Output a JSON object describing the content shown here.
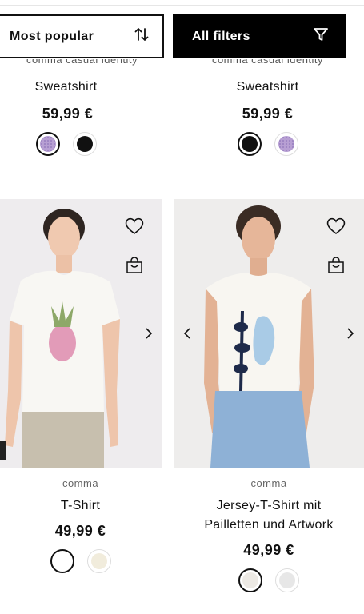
{
  "toolbar": {
    "sort_label": "Most popular",
    "filter_label": "All filters"
  },
  "products_top": [
    {
      "brand": "comma casual identity",
      "title": "Sweatshirt",
      "price": "59,99 €",
      "swatches": [
        {
          "color": "#b79fd3",
          "selected": true
        },
        {
          "color": "#111111",
          "selected": false
        }
      ]
    },
    {
      "brand": "comma casual identity",
      "title": "Sweatshirt",
      "price": "59,99 €",
      "swatches": [
        {
          "color": "#111111",
          "selected": true
        },
        {
          "color": "#b79fd3",
          "selected": false
        }
      ]
    }
  ],
  "products_bottom": [
    {
      "brand": "comma",
      "title": "T-Shirt",
      "price": "49,99 €",
      "swatches": [
        {
          "color": "#ffffff",
          "selected": true
        },
        {
          "color": "#f1ecdc",
          "selected": false
        }
      ]
    },
    {
      "brand": "comma",
      "title_line1": "Jersey-T-Shirt mit",
      "title_line2": "Pailletten und Artwork",
      "price": "49,99 €",
      "swatches": [
        {
          "color": "#ece9e4",
          "selected": true
        },
        {
          "color": "#e7e7e7",
          "selected": false
        }
      ]
    }
  ],
  "icons": {
    "sort": "sort-arrows-icon",
    "filter": "funnel-icon",
    "wishlist": "heart-icon",
    "cart": "shopping-bag-icon",
    "next": "chevron-right-icon",
    "prev": "chevron-left-icon"
  }
}
